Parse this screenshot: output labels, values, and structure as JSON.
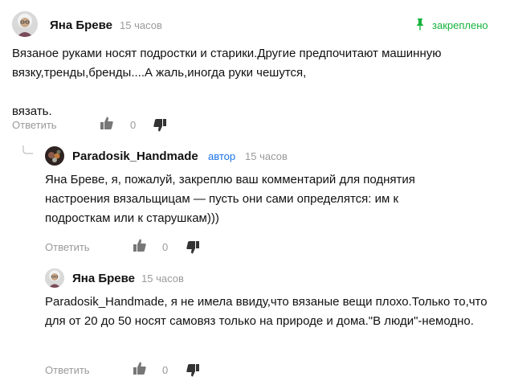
{
  "pinned_label": "закреплено",
  "colors": {
    "pinned": "#17b33d",
    "author_badge": "#1a73e8",
    "muted": "#9a9a9a"
  },
  "comments": [
    {
      "author": "Яна Бреве",
      "time": "15 часов",
      "text": "Вязаное руками носят подростки и старики.Другие предпочитают машинную вязку,тренды,бренды....А жаль,иногда руки чешутся,\n\nвязать.",
      "reply_label": "Ответить",
      "likes": "0",
      "avatar_icon": "grandma-avatar-icon"
    },
    {
      "author": "Paradosik_Handmade",
      "badge": "автор",
      "time": "15 часов",
      "text": "Яна Бреве, я, пожалуй, закреплю ваш комментарий для поднятия настроения вязальщицам — пусть они сами определятся: им к подросткам или к старушкам)))",
      "reply_label": "Ответить",
      "likes": "0",
      "avatar_icon": "channel-avatar-icon"
    },
    {
      "author": "Яна Бреве",
      "time": "15 часов",
      "text": "Paradosik_Handmade, я не имела ввиду,что вязаные вещи плохо.Только то,что для от 20 до 50 носят самовяз только на природе и дома.\"В люди\"-немодно.",
      "reply_label": "Ответить",
      "likes": "0",
      "avatar_icon": "grandma-avatar-icon"
    }
  ]
}
